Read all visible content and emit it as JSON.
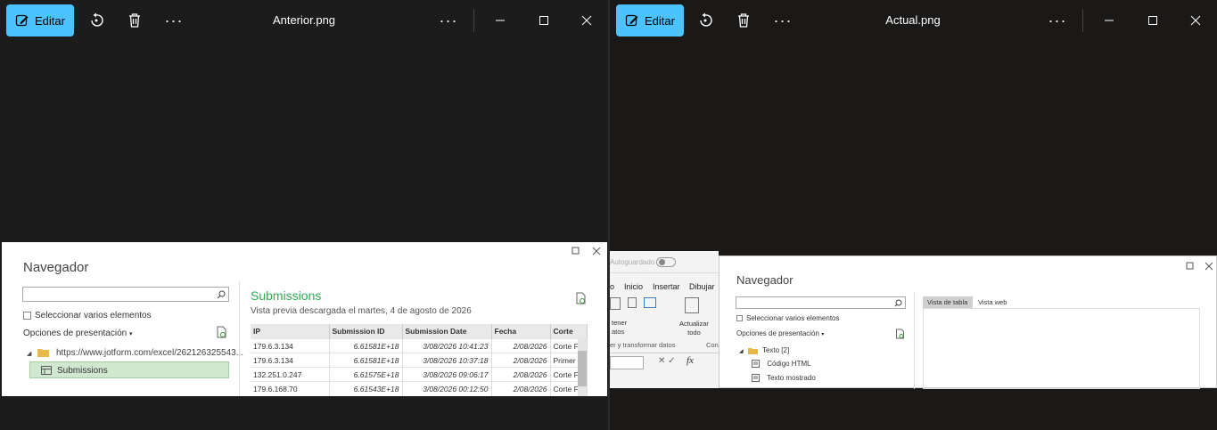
{
  "left": {
    "toolbar": {
      "edit_label": "Editar",
      "title": "Anterior.png"
    },
    "navigator": {
      "title": "Navegador",
      "select_multiple": "Seleccionar varios elementos",
      "display_options": "Opciones de presentación",
      "source_url": "https://www.jotform.com/excel/262126325543...",
      "selected_item": "Submissions",
      "preview_title": "Submissions",
      "preview_subtitle": "Vista previa descargada el martes, 4 de agosto de 2026",
      "columns": [
        "IP",
        "Submission ID",
        "Submission Date",
        "Fecha",
        "Corte"
      ],
      "rows": [
        [
          "179.6.3.134",
          "6.61581E+18",
          "3/08/2026 10:41:23",
          "2/08/2026",
          "Corte F"
        ],
        [
          "179.6.3.134",
          "6.61581E+18",
          "3/08/2026 10:37:18",
          "2/08/2026",
          "Primer"
        ],
        [
          "132.251.0.247",
          "6.61575E+18",
          "3/08/2026 09:06:17",
          "2/08/2026",
          "Corte F"
        ],
        [
          "179.6.168.70",
          "6.61543E+18",
          "3/08/2026 00:12:50",
          "2/08/2026",
          "Corte F"
        ]
      ]
    }
  },
  "right": {
    "toolbar": {
      "edit_label": "Editar",
      "title": "Actual.png"
    },
    "excel": {
      "autosave": "Autoguardado",
      "tabs": [
        "o",
        "Inicio",
        "Insertar",
        "Dibujar"
      ],
      "get_data_partial": "tener\natos",
      "refresh_label": "Actualizar\ntodo",
      "group_label": "er y transformar datos",
      "group_label2": "Con",
      "fx": "fx"
    },
    "navigator": {
      "title": "Navegador",
      "select_multiple": "Seleccionar varios elementos",
      "display_options": "Opciones de presentación",
      "folder": "Texto [2]",
      "items": [
        "Código HTML",
        "Texto mostrado"
      ],
      "tab_table": "Vista de tabla",
      "tab_web": "Vista web"
    }
  }
}
